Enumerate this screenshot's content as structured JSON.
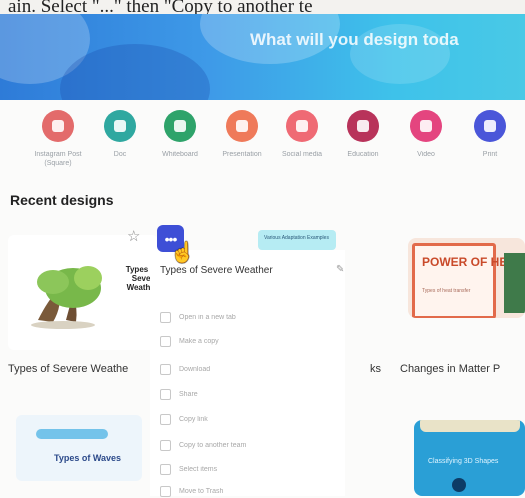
{
  "caption": "ain. Select \"...\" then \"Copy to another te",
  "banner": {
    "title": "What will you design toda"
  },
  "categories": [
    {
      "label": "Instagram Post (Square)",
      "color": "#e36b6b"
    },
    {
      "label": "Doc",
      "color": "#2fa8a0"
    },
    {
      "label": "Whiteboard",
      "color": "#2ea36a"
    },
    {
      "label": "Presentation",
      "color": "#ef7a5a"
    },
    {
      "label": "Social media",
      "color": "#ef6a74"
    },
    {
      "label": "Education",
      "color": "#b8335a"
    },
    {
      "label": "Video",
      "color": "#e4457f"
    },
    {
      "label": "Print",
      "color": "#4a56d9"
    }
  ],
  "recent": {
    "title": "Recent designs",
    "cards": [
      {
        "thumb_title": "Types of Severe Weather",
        "label": "Types of Severe Weathe"
      },
      {
        "thumb_title": "Various Adaptation Examples",
        "label": "ks"
      },
      {
        "thumb_title": "POWER OF HEAT",
        "thumb_sub": "Types of heat transfer",
        "label": "Changes in Matter P"
      },
      {
        "thumb_title": "Types of Waves",
        "label": ""
      },
      {
        "thumb_title": "Classifying 3D Shapes",
        "label": ""
      }
    ],
    "menu": {
      "title": "Types of Severe Weather",
      "edit_icon": "pencil-icon",
      "items": [
        {
          "label": "Open in a new tab",
          "icon": "external-link-icon"
        },
        {
          "label": "Make a copy",
          "icon": "copy-icon"
        },
        {
          "label": "Download",
          "icon": "download-icon"
        },
        {
          "label": "Share",
          "icon": "share-icon"
        },
        {
          "label": "Copy link",
          "icon": "link-icon"
        },
        {
          "label": "Copy to another team",
          "icon": "team-icon"
        },
        {
          "label": "Select items",
          "icon": "select-icon"
        },
        {
          "label": "Move to Trash",
          "icon": "trash-icon"
        }
      ]
    }
  }
}
